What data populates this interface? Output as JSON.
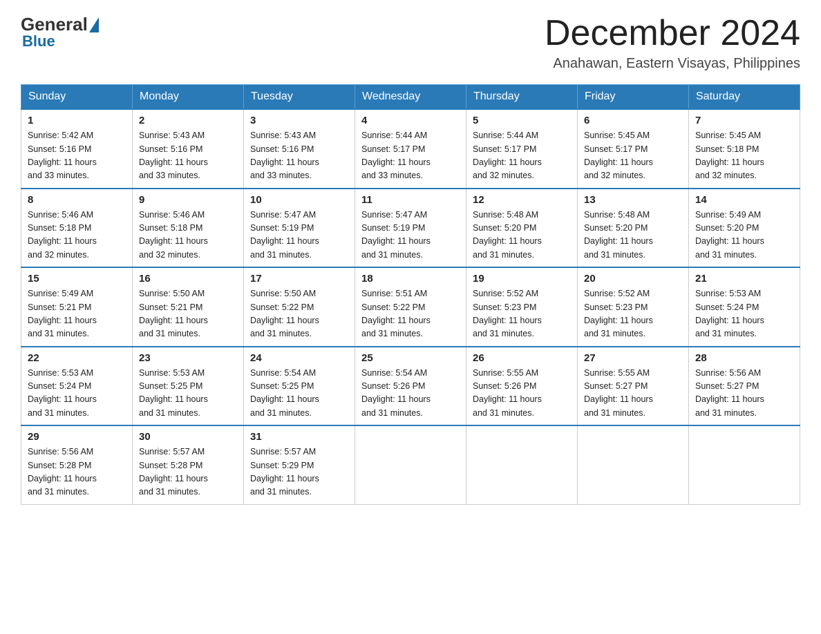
{
  "header": {
    "logo": {
      "general": "General",
      "blue": "Blue"
    },
    "title": "December 2024",
    "location": "Anahawan, Eastern Visayas, Philippines"
  },
  "days_of_week": [
    "Sunday",
    "Monday",
    "Tuesday",
    "Wednesday",
    "Thursday",
    "Friday",
    "Saturday"
  ],
  "weeks": [
    [
      {
        "day": "1",
        "sunrise": "5:42 AM",
        "sunset": "5:16 PM",
        "daylight": "11 hours and 33 minutes."
      },
      {
        "day": "2",
        "sunrise": "5:43 AM",
        "sunset": "5:16 PM",
        "daylight": "11 hours and 33 minutes."
      },
      {
        "day": "3",
        "sunrise": "5:43 AM",
        "sunset": "5:16 PM",
        "daylight": "11 hours and 33 minutes."
      },
      {
        "day": "4",
        "sunrise": "5:44 AM",
        "sunset": "5:17 PM",
        "daylight": "11 hours and 33 minutes."
      },
      {
        "day": "5",
        "sunrise": "5:44 AM",
        "sunset": "5:17 PM",
        "daylight": "11 hours and 32 minutes."
      },
      {
        "day": "6",
        "sunrise": "5:45 AM",
        "sunset": "5:17 PM",
        "daylight": "11 hours and 32 minutes."
      },
      {
        "day": "7",
        "sunrise": "5:45 AM",
        "sunset": "5:18 PM",
        "daylight": "11 hours and 32 minutes."
      }
    ],
    [
      {
        "day": "8",
        "sunrise": "5:46 AM",
        "sunset": "5:18 PM",
        "daylight": "11 hours and 32 minutes."
      },
      {
        "day": "9",
        "sunrise": "5:46 AM",
        "sunset": "5:18 PM",
        "daylight": "11 hours and 32 minutes."
      },
      {
        "day": "10",
        "sunrise": "5:47 AM",
        "sunset": "5:19 PM",
        "daylight": "11 hours and 31 minutes."
      },
      {
        "day": "11",
        "sunrise": "5:47 AM",
        "sunset": "5:19 PM",
        "daylight": "11 hours and 31 minutes."
      },
      {
        "day": "12",
        "sunrise": "5:48 AM",
        "sunset": "5:20 PM",
        "daylight": "11 hours and 31 minutes."
      },
      {
        "day": "13",
        "sunrise": "5:48 AM",
        "sunset": "5:20 PM",
        "daylight": "11 hours and 31 minutes."
      },
      {
        "day": "14",
        "sunrise": "5:49 AM",
        "sunset": "5:20 PM",
        "daylight": "11 hours and 31 minutes."
      }
    ],
    [
      {
        "day": "15",
        "sunrise": "5:49 AM",
        "sunset": "5:21 PM",
        "daylight": "11 hours and 31 minutes."
      },
      {
        "day": "16",
        "sunrise": "5:50 AM",
        "sunset": "5:21 PM",
        "daylight": "11 hours and 31 minutes."
      },
      {
        "day": "17",
        "sunrise": "5:50 AM",
        "sunset": "5:22 PM",
        "daylight": "11 hours and 31 minutes."
      },
      {
        "day": "18",
        "sunrise": "5:51 AM",
        "sunset": "5:22 PM",
        "daylight": "11 hours and 31 minutes."
      },
      {
        "day": "19",
        "sunrise": "5:52 AM",
        "sunset": "5:23 PM",
        "daylight": "11 hours and 31 minutes."
      },
      {
        "day": "20",
        "sunrise": "5:52 AM",
        "sunset": "5:23 PM",
        "daylight": "11 hours and 31 minutes."
      },
      {
        "day": "21",
        "sunrise": "5:53 AM",
        "sunset": "5:24 PM",
        "daylight": "11 hours and 31 minutes."
      }
    ],
    [
      {
        "day": "22",
        "sunrise": "5:53 AM",
        "sunset": "5:24 PM",
        "daylight": "11 hours and 31 minutes."
      },
      {
        "day": "23",
        "sunrise": "5:53 AM",
        "sunset": "5:25 PM",
        "daylight": "11 hours and 31 minutes."
      },
      {
        "day": "24",
        "sunrise": "5:54 AM",
        "sunset": "5:25 PM",
        "daylight": "11 hours and 31 minutes."
      },
      {
        "day": "25",
        "sunrise": "5:54 AM",
        "sunset": "5:26 PM",
        "daylight": "11 hours and 31 minutes."
      },
      {
        "day": "26",
        "sunrise": "5:55 AM",
        "sunset": "5:26 PM",
        "daylight": "11 hours and 31 minutes."
      },
      {
        "day": "27",
        "sunrise": "5:55 AM",
        "sunset": "5:27 PM",
        "daylight": "11 hours and 31 minutes."
      },
      {
        "day": "28",
        "sunrise": "5:56 AM",
        "sunset": "5:27 PM",
        "daylight": "11 hours and 31 minutes."
      }
    ],
    [
      {
        "day": "29",
        "sunrise": "5:56 AM",
        "sunset": "5:28 PM",
        "daylight": "11 hours and 31 minutes."
      },
      {
        "day": "30",
        "sunrise": "5:57 AM",
        "sunset": "5:28 PM",
        "daylight": "11 hours and 31 minutes."
      },
      {
        "day": "31",
        "sunrise": "5:57 AM",
        "sunset": "5:29 PM",
        "daylight": "11 hours and 31 minutes."
      },
      null,
      null,
      null,
      null
    ]
  ],
  "labels": {
    "sunrise": "Sunrise:",
    "sunset": "Sunset:",
    "daylight": "Daylight:"
  }
}
